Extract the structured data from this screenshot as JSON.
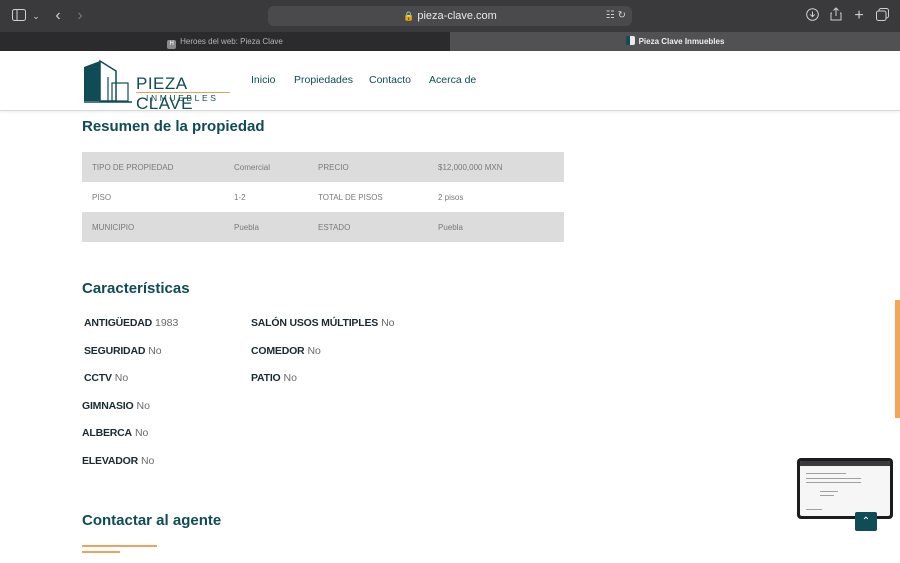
{
  "browser": {
    "url": "pieza-clave.com",
    "tabs": [
      {
        "label": "Heroes del web: Pieza Clave",
        "favicon_letter": "H"
      },
      {
        "label": "Pieza Clave Inmuebles"
      }
    ],
    "icons": [
      "sidebar-icon",
      "chevron-down-icon",
      "back-icon",
      "forward-icon",
      "lock-icon",
      "translate-icon",
      "reload-icon",
      "download-icon",
      "share-icon",
      "new-tab-icon",
      "tab-overview-icon"
    ]
  },
  "site": {
    "logo_title": "PIEZA CLAVE",
    "logo_subtitle": "INMUEBLES",
    "nav": [
      "Inicio",
      "Propiedades",
      "Contacto",
      "Acerca de"
    ],
    "brand_color": "#0f4c55",
    "accent_color": "#f0a25a"
  },
  "summary": {
    "title": "Resumen de la propiedad",
    "rows": [
      [
        "TIPO DE PROPIEDAD",
        "Comercial",
        "PRECIO",
        "$12,000,000 MXN"
      ],
      [
        "PISO",
        "1-2",
        "TOTAL DE PISOS",
        "2 pisos"
      ],
      [
        "MUNICIPIO",
        "Puebla",
        "ESTADO",
        "Puebla"
      ]
    ]
  },
  "features": {
    "title": "Características",
    "left": [
      {
        "label": "ANTIGÜEDAD",
        "value": "1983"
      },
      {
        "label": "SEGURIDAD",
        "value": "No"
      },
      {
        "label": "CCTV",
        "value": "No"
      },
      {
        "label": "GIMNASIO",
        "value": "No"
      },
      {
        "label": "ALBERCA",
        "value": "No"
      },
      {
        "label": "ELEVADOR",
        "value": "No"
      }
    ],
    "right": [
      {
        "label": "SALÓN USOS MÚLTIPLES",
        "value": "No"
      },
      {
        "label": "COMEDOR",
        "value": "No"
      },
      {
        "label": "PATIO",
        "value": "No"
      }
    ]
  },
  "contact": {
    "title": "Contactar al agente"
  },
  "scroll_top_icon": "chevron-up-icon"
}
